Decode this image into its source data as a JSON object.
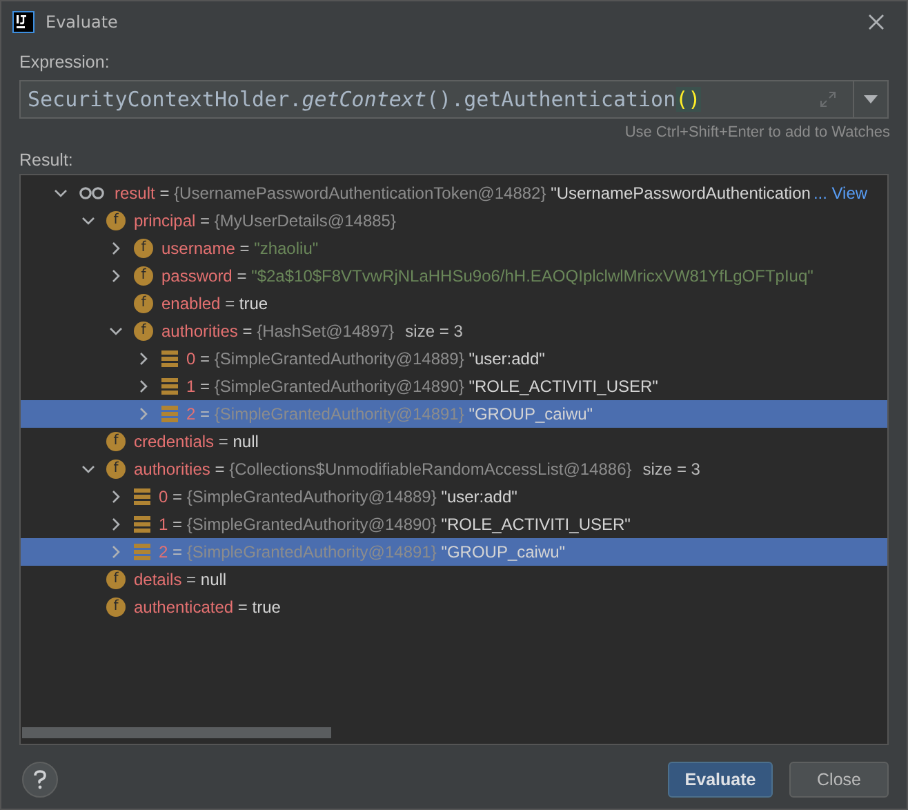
{
  "window": {
    "title": "Evaluate"
  },
  "expression": {
    "label": "Expression:",
    "value": "SecurityContextHolder.*getContext*().getAuthentication",
    "parens": "()",
    "hint": "Use Ctrl+Shift+Enter to add to Watches"
  },
  "result": {
    "label": "Result:",
    "tree": [
      {
        "kind": "watch",
        "name": "result",
        "eq": "=",
        "ref": "{UsernamePasswordAuthenticationToken@14882}",
        "value": {
          "text": "\"UsernamePasswordAuthentication",
          "kind": "plain"
        },
        "link": "... View",
        "expanded": true,
        "selected": false,
        "children": [
          {
            "kind": "field",
            "badge": "f",
            "name": "principal",
            "eq": "=",
            "ref": "{MyUserDetails@14885}",
            "expanded": true,
            "selected": false,
            "children": [
              {
                "kind": "field",
                "badge": "f",
                "name": "username",
                "eq": "=",
                "value": {
                  "text": "\"zhaoliu\"",
                  "kind": "string"
                },
                "expanded": false,
                "selected": false
              },
              {
                "kind": "field",
                "badge": "f",
                "name": "password",
                "eq": "=",
                "value": {
                  "text": "\"$2a$10$F8VTvwRjNLaHHSu9o6/hH.EAOQIplclwlMricxVW81YfLgOFTpIuq\"",
                  "kind": "string"
                },
                "expanded": false,
                "selected": false
              },
              {
                "kind": "field",
                "badge": "f",
                "name": "enabled",
                "eq": "=",
                "value": {
                  "text": "true",
                  "kind": "plain"
                },
                "selected": false
              },
              {
                "kind": "field",
                "badge": "f",
                "name": "authorities",
                "eq": "=",
                "ref": "{HashSet@14897}",
                "size": "size = 3",
                "expanded": true,
                "selected": false,
                "children": [
                  {
                    "kind": "element",
                    "name": "0",
                    "eq": "=",
                    "ref": "{SimpleGrantedAuthority@14889}",
                    "value": {
                      "text": "\"user:add\"",
                      "kind": "plain"
                    },
                    "expanded": false,
                    "selected": false
                  },
                  {
                    "kind": "element",
                    "name": "1",
                    "eq": "=",
                    "ref": "{SimpleGrantedAuthority@14890}",
                    "value": {
                      "text": "\"ROLE_ACTIVITI_USER\"",
                      "kind": "plain"
                    },
                    "expanded": false,
                    "selected": false
                  },
                  {
                    "kind": "element",
                    "name": "2",
                    "eq": "=",
                    "ref": "{SimpleGrantedAuthority@14891}",
                    "value": {
                      "text": "\"GROUP_caiwu\"",
                      "kind": "plain"
                    },
                    "expanded": false,
                    "selected": true
                  }
                ]
              }
            ]
          },
          {
            "kind": "field",
            "badge": "f",
            "name": "credentials",
            "eq": "=",
            "value": {
              "text": "null",
              "kind": "plain"
            },
            "selected": false
          },
          {
            "kind": "field",
            "badge": "f",
            "name": "authorities",
            "eq": "=",
            "ref": "{Collections$UnmodifiableRandomAccessList@14886}",
            "size": "size = 3",
            "expanded": true,
            "selected": false,
            "children": [
              {
                "kind": "element",
                "name": "0",
                "eq": "=",
                "ref": "{SimpleGrantedAuthority@14889}",
                "value": {
                  "text": "\"user:add\"",
                  "kind": "plain"
                },
                "expanded": false,
                "selected": false
              },
              {
                "kind": "element",
                "name": "1",
                "eq": "=",
                "ref": "{SimpleGrantedAuthority@14890}",
                "value": {
                  "text": "\"ROLE_ACTIVITI_USER\"",
                  "kind": "plain"
                },
                "expanded": false,
                "selected": false
              },
              {
                "kind": "element",
                "name": "2",
                "eq": "=",
                "ref": "{SimpleGrantedAuthority@14891}",
                "value": {
                  "text": "\"GROUP_caiwu\"",
                  "kind": "plain"
                },
                "expanded": false,
                "selected": true
              }
            ]
          },
          {
            "kind": "field",
            "badge": "f",
            "name": "details",
            "eq": "=",
            "value": {
              "text": "null",
              "kind": "plain"
            },
            "selected": false
          },
          {
            "kind": "field",
            "badge": "f",
            "name": "authenticated",
            "eq": "=",
            "value": {
              "text": "true",
              "kind": "plain"
            },
            "selected": false
          }
        ]
      }
    ]
  },
  "buttons": [
    {
      "label": "Evaluate",
      "kind": "primary"
    },
    {
      "label": "Close",
      "kind": "secondary"
    }
  ]
}
